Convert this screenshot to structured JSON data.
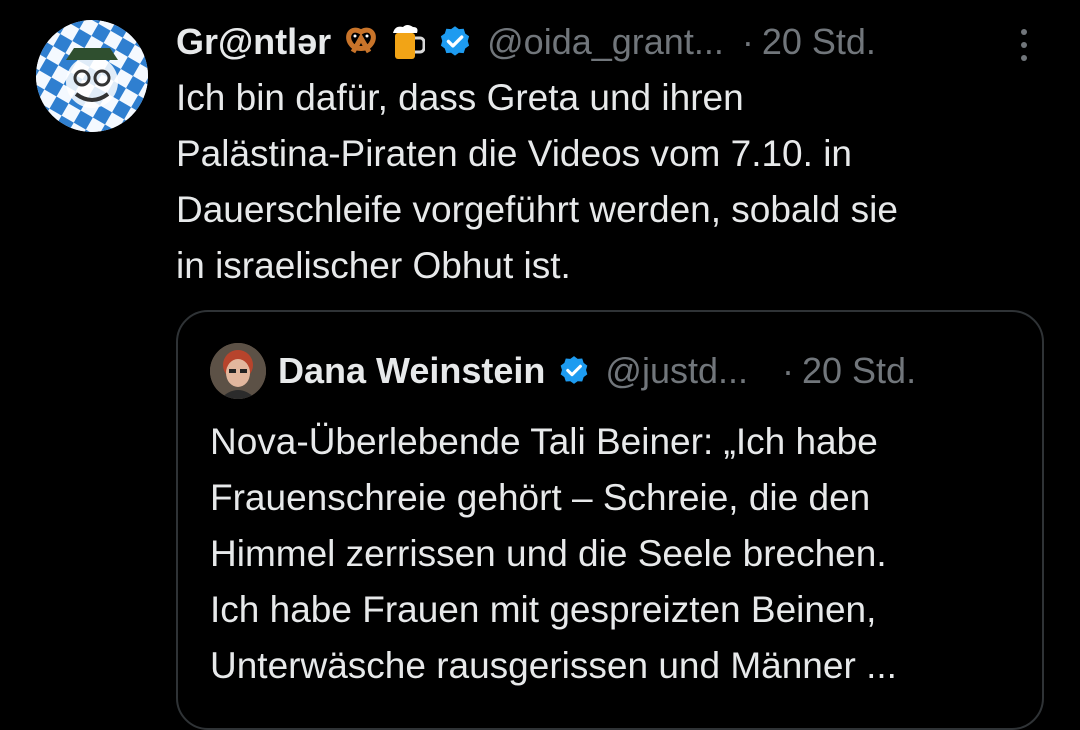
{
  "tweet": {
    "author_name": "Gr@ntlər",
    "emojis": [
      "pretzel-icon",
      "beer-mug-icon"
    ],
    "verified": true,
    "handle": "@oida_grant...",
    "separator": "·",
    "time": "20 Std.",
    "text_lines": [
      "Ich bin dafür, dass Greta und ihren",
      "Palästina-Piraten die Videos vom 7.10. in",
      "Dauerschleife vorgeführt werden, sobald sie",
      "in israelischer Obhut ist."
    ]
  },
  "quote": {
    "author_name": "Dana Weinstein",
    "verified": true,
    "handle": "@justd...",
    "separator": "·",
    "time": "20 Std.",
    "text_lines": [
      "Nova-Überlebende Tali Beiner: „Ich habe",
      "Frauenschreie gehört – Schreie, die den",
      "Himmel zerrissen und die Seele brechen.",
      "Ich habe Frauen mit gespreizten Beinen,",
      "Unterwäsche rausgerissen und Männer ..."
    ]
  },
  "colors": {
    "background": "#000000",
    "text": "#e7e9ea",
    "muted": "#71767b",
    "verified_blue": "#1d9bf0",
    "border": "#2f3336"
  }
}
